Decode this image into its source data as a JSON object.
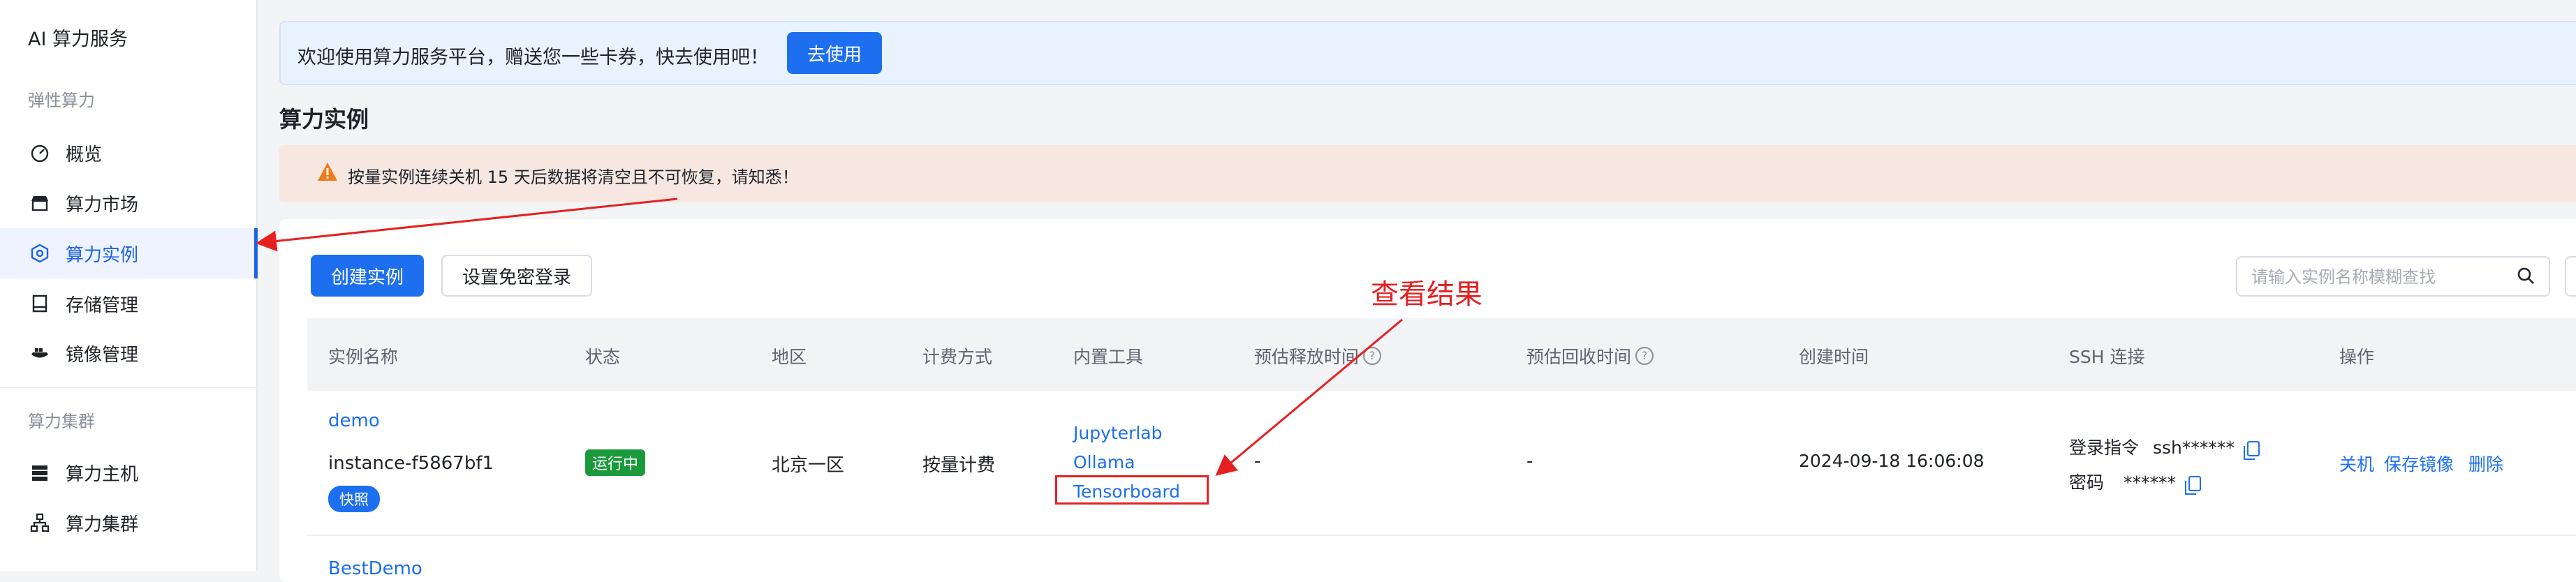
{
  "app_title": "AI 算力服务",
  "sidebar": {
    "section_elastic": "弹性算力",
    "section_cluster": "算力集群",
    "items": [
      {
        "label": "概览",
        "icon": "dashboard-icon"
      },
      {
        "label": "算力市场",
        "icon": "market-icon"
      },
      {
        "label": "算力实例",
        "icon": "instance-icon",
        "active": true
      },
      {
        "label": "存储管理",
        "icon": "storage-icon"
      },
      {
        "label": "镜像管理",
        "icon": "image-icon"
      },
      {
        "label": "算力主机",
        "icon": "server-icon"
      },
      {
        "label": "算力集群",
        "icon": "cluster-icon"
      }
    ]
  },
  "notice": {
    "text": "欢迎使用算力服务平台，赠送您一些卡券，快去使用吧！",
    "button": "去使用"
  },
  "page_title": "算力实例",
  "warning": {
    "text": "按量实例连续关机 15 天后数据将清空且不可恢复，请知悉！"
  },
  "toolbar": {
    "create_button": "创建实例",
    "passwordless_button": "设置免密登录",
    "search_placeholder": "请输入实例名称模糊查找"
  },
  "table": {
    "columns": [
      "实例名称",
      "状态",
      "地区",
      "计费方式",
      "内置工具",
      "预估释放时间",
      "预估回收时间",
      "创建时间",
      "SSH 连接",
      "操作"
    ],
    "rows": [
      {
        "name": "demo",
        "instance_id": "instance-f5867bf1",
        "snapshot_tag": "快照",
        "status": "运行中",
        "region": "北京一区",
        "billing": "按量计费",
        "tools": [
          "Jupyterlab",
          "Ollama",
          "Tensorboard"
        ],
        "release_time": "-",
        "recycle_time": "-",
        "created_at": "2024-09-18 16:06:08",
        "ssh_login_label": "登录指令",
        "ssh_login_value": "ssh******",
        "ssh_password_label": "密码",
        "ssh_password_value": "******",
        "actions": [
          "关机",
          "保存镜像",
          "删除"
        ]
      },
      {
        "name": "BestDemo"
      }
    ]
  },
  "annotation": {
    "label": "查看结果",
    "color": "#e62020"
  },
  "colors": {
    "primary": "#1d6fef",
    "running": "#1b9a3c",
    "warning_icon": "#f07a1a"
  }
}
